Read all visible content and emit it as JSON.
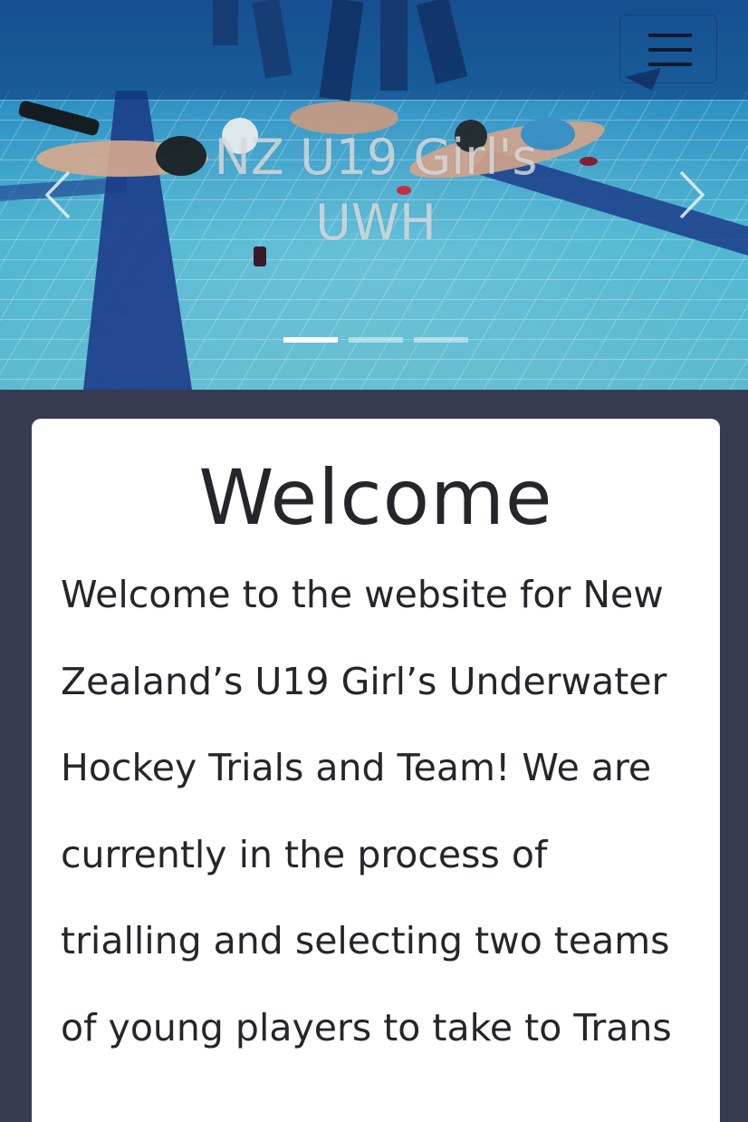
{
  "navbar": {
    "menu_toggle_icon": "hamburger-menu-icon"
  },
  "carousel": {
    "caption": "NZ U19 Girl's UWH",
    "prev_icon": "chevron-left-icon",
    "next_icon": "chevron-right-icon",
    "active_slide": 0,
    "slide_count": 3,
    "image": "underwater-hockey-pool-photo"
  },
  "welcome": {
    "title": "Welcome",
    "body": "Welcome to the website for New Zealand’s U19 Girl’s Underwater Hockey Trials and Team! We are currently in the process of trialling and selecting two teams of young players to take to Trans"
  },
  "colors": {
    "page_background": "#363b52",
    "card_background": "#ffffff",
    "text": "#24262b",
    "pool_water": "#3aa6c8",
    "pool_lane_line": "#1c3c8a"
  }
}
